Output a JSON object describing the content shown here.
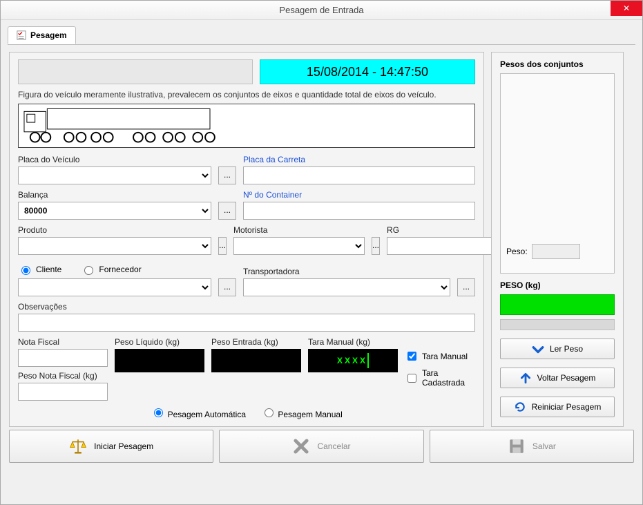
{
  "window": {
    "title": "Pesagem de Entrada"
  },
  "tab": {
    "label": "Pesagem"
  },
  "header": {
    "datetime": "15/08/2014 - 14:47:50",
    "note": "Figura do veículo meramente ilustrativa, prevalecem os conjuntos de eixos e quantidade total de eixos do veículo."
  },
  "form": {
    "placa_veiculo": {
      "label": "Placa do Veículo",
      "value": ""
    },
    "placa_carreta": {
      "label": "Placa da Carreta",
      "value": ""
    },
    "balanca": {
      "label": "Balança",
      "value": "80000"
    },
    "num_container": {
      "label": "Nº do Container",
      "value": ""
    },
    "produto": {
      "label": "Produto",
      "value": ""
    },
    "motorista": {
      "label": "Motorista",
      "value": ""
    },
    "rg": {
      "label": "RG",
      "value": ""
    },
    "tipo_cliente": {
      "opt1": "Cliente",
      "opt2": "Fornecedor"
    },
    "cliente_fornecedor": {
      "value": ""
    },
    "transportadora": {
      "label": "Transportadora",
      "value": ""
    },
    "observacoes": {
      "label": "Observações",
      "value": ""
    },
    "nota_fiscal": {
      "label": "Nota Fiscal",
      "value": ""
    },
    "peso_nota_fiscal": {
      "label": "Peso Nota Fiscal (kg)",
      "value": ""
    },
    "peso_liquido": {
      "label": "Peso Líquido (kg)",
      "value": ""
    },
    "peso_entrada": {
      "label": "Peso Entrada (kg)",
      "value": ""
    },
    "tara_manual": {
      "label": "Tara Manual (kg)",
      "value": "XXXX"
    },
    "chk_tara_manual": "Tara Manual",
    "chk_tara_cadastrada": "Tara Cadastrada",
    "modo_auto": "Pesagem Automática",
    "modo_manual": "Pesagem Manual"
  },
  "side": {
    "group_title": "Pesos dos conjuntos",
    "peso_label": "Peso:",
    "peso_value": "",
    "kg_title": "PESO (kg)",
    "btn_ler": "Ler Peso",
    "btn_voltar": "Voltar Pesagem",
    "btn_reiniciar": "Reiniciar Pesagem"
  },
  "footer": {
    "iniciar": "Iniciar Pesagem",
    "cancelar": "Cancelar",
    "salvar": "Salvar"
  }
}
